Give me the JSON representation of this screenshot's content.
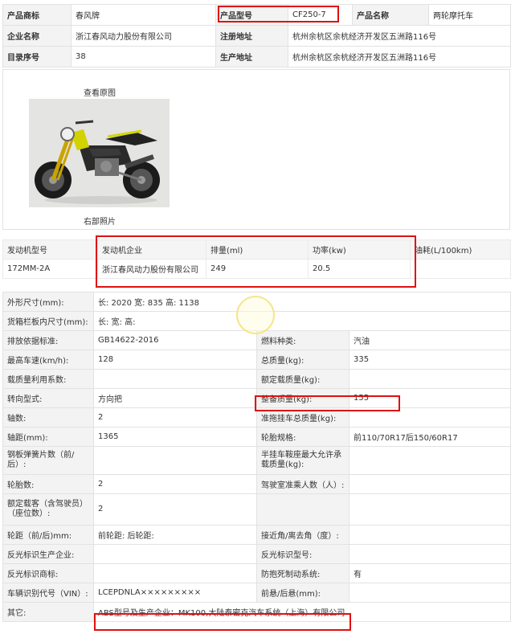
{
  "basic_info": [
    [
      "产品商标",
      "春风牌",
      "产品型号",
      "CF250-7",
      "产品名称",
      "两轮摩托车"
    ],
    [
      "企业名称",
      "浙江春风动力股份有限公司",
      "注册地址",
      "杭州余杭区余杭经济开发区五洲路116号"
    ],
    [
      "目录序号",
      "38",
      "生产地址",
      "杭州余杭区余杭经济开发区五洲路116号"
    ]
  ],
  "photo": {
    "view_original": "查看原图",
    "caption": "右部照片"
  },
  "engine": {
    "headers": [
      "发动机型号",
      "发动机企业",
      "排量(ml)",
      "功率(kw)",
      "油耗(L/100km)"
    ],
    "row": [
      "172MM-2A",
      "浙江春风动力股份有限公司",
      "249",
      "20.5",
      ""
    ]
  },
  "specs": {
    "dimensions": [
      "外形尺寸(mm):",
      "长: 2020 宽: 835 高: 1138"
    ],
    "cargo": [
      "货箱栏板内尺寸(mm):",
      "长:    宽:    高:"
    ],
    "rows": [
      [
        "排放依据标准:",
        "GB14622-2016",
        "燃料种类:",
        "汽油"
      ],
      [
        "最高车速(km/h):",
        "128",
        "总质量(kg):",
        "335"
      ],
      [
        "载质量利用系数:",
        "",
        "额定载质量(kg):",
        ""
      ],
      [
        "转向型式:",
        "方向把",
        "整备质量(kg):",
        "155"
      ],
      [
        "轴数:",
        "2",
        "准拖挂车总质量(kg):",
        ""
      ],
      [
        "轴距(mm):",
        "1365",
        "轮胎规格:",
        "前110/70R17后150/60R17"
      ],
      [
        "钢板弹簧片数（前/后）:",
        "",
        "半挂车鞍座最大允许承载质量(kg):",
        ""
      ],
      [
        "轮胎数:",
        "2",
        "驾驶室准乘人数（人）:",
        ""
      ],
      [
        "额定载客（含驾驶员）（座位数）:",
        "2",
        "",
        ""
      ],
      [
        "轮距（前/后)mm:",
        "前轮距: 后轮距:",
        "接近角/离去角（度）:",
        ""
      ],
      [
        "反光标识生产企业:",
        "",
        "反光标识型号:",
        ""
      ],
      [
        "反光标识商标:",
        "",
        "防抱死制动系统:",
        "有"
      ],
      [
        "车辆识别代号（VIN）:",
        "LCEPDNLA×××××××××",
        "前悬/后悬(mm):",
        ""
      ]
    ],
    "other": [
      "其它:",
      "ABS型号及生产企业：MK100,大陆泰密克汽车系统（上海）有限公司"
    ]
  }
}
